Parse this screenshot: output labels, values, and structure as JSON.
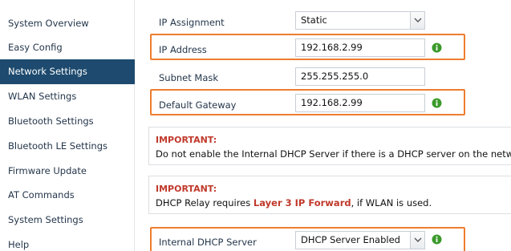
{
  "sidebar": {
    "items": [
      {
        "label": "System Overview",
        "active": false
      },
      {
        "label": "Easy Config",
        "active": false
      },
      {
        "label": "Network Settings",
        "active": true
      },
      {
        "label": "WLAN Settings",
        "active": false
      },
      {
        "label": "Bluetooth Settings",
        "active": false
      },
      {
        "label": "Bluetooth LE Settings",
        "active": false
      },
      {
        "label": "Firmware Update",
        "active": false
      },
      {
        "label": "AT Commands",
        "active": false
      },
      {
        "label": "System Settings",
        "active": false
      },
      {
        "label": "Help",
        "active": false
      }
    ]
  },
  "form": {
    "ip_assignment": {
      "label": "IP Assignment",
      "value": "Static"
    },
    "ip_address": {
      "label": "IP Address",
      "value": "192.168.2.99",
      "status_icon": "check-circle-icon"
    },
    "subnet_mask": {
      "label": "Subnet Mask",
      "value": "255.255.255.0"
    },
    "default_gateway": {
      "label": "Default Gateway",
      "value": "192.168.2.99",
      "status_icon": "check-circle-icon"
    },
    "dhcp_server": {
      "label": "Internal DHCP Server",
      "value": "DHCP Server Enabled",
      "status_icon": "check-circle-icon"
    }
  },
  "notes": [
    {
      "title": "IMPORTANT:",
      "text": "Do not enable the Internal DHCP Server if there is a DHCP server on the network."
    },
    {
      "title": "IMPORTANT:",
      "text_before": "DHCP Relay requires ",
      "text_link": "Layer 3 IP Forward",
      "text_after": ", if WLAN is used."
    }
  ],
  "colors": {
    "sidebar_active_bg": "#1d4a6e",
    "highlight_border": "#ee7d2f",
    "ok_icon": "#3a9a2a",
    "important_red": "#c0392b"
  }
}
